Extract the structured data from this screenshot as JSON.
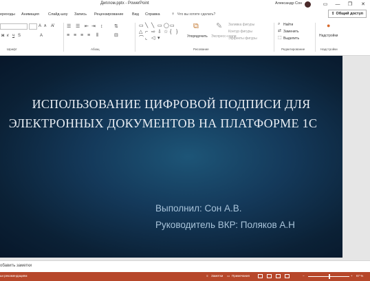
{
  "window": {
    "title": "Диплом.pptx - PowerPoint",
    "user": "Александр Сон",
    "controls": {
      "minimize": "—",
      "restore": "❐",
      "close": "✕"
    }
  },
  "menu": {
    "tabs": [
      "ереходы",
      "Анимация",
      "Слайд-шоу",
      "Запись",
      "Рецензирование",
      "Вид",
      "Справка"
    ],
    "search_placeholder": "Что вы хотите сделать?",
    "share_label": "Общий доступ"
  },
  "ribbon": {
    "groups": {
      "font": "Шрифт",
      "paragraph": "Абзац",
      "drawing": "Рисование",
      "editing": "Редактирование",
      "addins": "Надстройки"
    },
    "drawing": {
      "arrange": "Упорядочить",
      "quick_styles": "Экспресс-стили",
      "shape_fill": "Заливка фигуры",
      "shape_outline": "Контур фигуры",
      "shape_effects": "Эффекты фигуры"
    },
    "editing": {
      "find": "Найти",
      "replace": "Заменить",
      "select": "Выделить"
    },
    "addins": {
      "label": "Надстройки"
    }
  },
  "slide": {
    "title_lines": [
      "ИСПОЛЬЗОВАНИЕ ЦИФРОВОЙ ПОДПИСИ ДЛЯ",
      "ЭЛЕКТРОННЫХ ДОКУМЕНТОВ НА ПЛАТФОРМЕ 1С"
    ],
    "performer": "Выполнил: Сон А.В.",
    "supervisor": "Руководитель ВКР: Поляков А.Н"
  },
  "notes": {
    "placeholder": "обавить заметки"
  },
  "status": {
    "accessibility": "ьи рекомендациям",
    "notes_btn": "Заметки",
    "comments_btn": "Примечания",
    "zoom": "67 %"
  },
  "colors": {
    "status_bar": "#b7472a",
    "slide_bg_center": "#1d5577",
    "slide_bg_edge": "#07172a",
    "title_text": "#e9eef4",
    "subtitle_text": "#a9c4da"
  }
}
